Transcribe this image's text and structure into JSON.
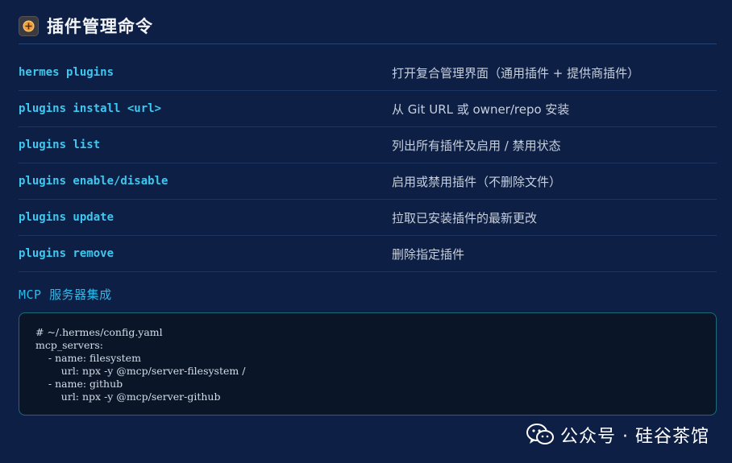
{
  "header": {
    "title": "插件管理命令",
    "icon": "plugin-icon",
    "icon_glyph": "⊕"
  },
  "commands": [
    {
      "name": "hermes plugins",
      "desc": "打开复合管理界面（通用插件 + 提供商插件）"
    },
    {
      "name": "plugins install <url>",
      "desc": "从 Git URL 或 owner/repo 安装"
    },
    {
      "name": "plugins list",
      "desc": "列出所有插件及启用 / 禁用状态"
    },
    {
      "name": "plugins enable/disable",
      "desc": "启用或禁用插件（不删除文件）"
    },
    {
      "name": "plugins update",
      "desc": "拉取已安装插件的最新更改"
    },
    {
      "name": "plugins remove",
      "desc": "删除指定插件"
    }
  ],
  "mcp_section": {
    "title": "MCP 服务器集成",
    "code_lines": [
      "# ~/.hermes/config.yaml",
      "mcp_servers:",
      "    - name: filesystem",
      "        url: npx -y @mcp/server-filesystem /",
      "    - name: github",
      "        url: npx -y @mcp/server-github"
    ]
  },
  "watermark": {
    "text": "公众号 · 硅谷茶馆",
    "icon": "wechat-icon"
  },
  "colors": {
    "background": "#0d1f44",
    "command_text": "#3ec7f0",
    "code_border": "#1a6b7a"
  }
}
